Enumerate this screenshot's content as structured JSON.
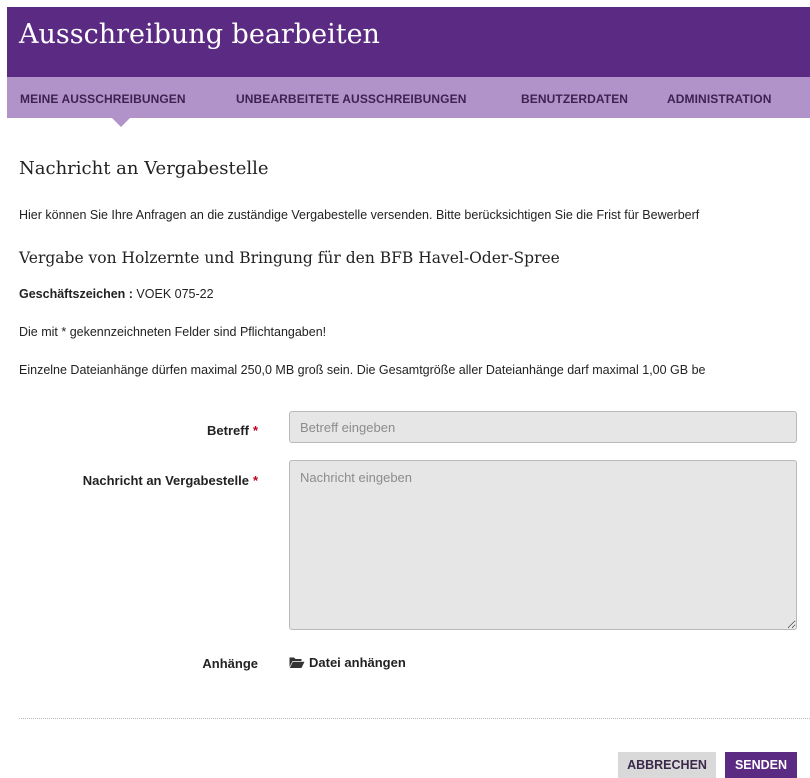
{
  "header": {
    "title": "Ausschreibung bearbeiten"
  },
  "nav": {
    "items": [
      {
        "label": "MEINE AUSSCHREIBUNGEN"
      },
      {
        "label": "UNBEARBEITETE AUSSCHREIBUNGEN"
      },
      {
        "label": "BENUTZERDATEN"
      },
      {
        "label": "ADMINISTRATION"
      }
    ],
    "active_index": 0
  },
  "page": {
    "title": "Nachricht an Vergabestelle",
    "intro": "Hier können Sie Ihre Anfragen an die zuständige Vergabestelle versenden. Bitte berücksichtigen Sie die Frist für Bewerberf",
    "tender_title": "Vergabe von Holzernte und Bringung für den BFB Havel-Oder-Spree",
    "reference_label": "Geschäftszeichen :",
    "reference_value": "VOEK 075-22",
    "required_note": "Die mit * gekennzeichneten Felder sind Pflichtangaben!",
    "file_note": "Einzelne Dateianhänge dürfen maximal 250,0 MB groß sein. Die Gesamtgröße aller Dateianhänge darf maximal 1,00 GB be"
  },
  "form": {
    "subject": {
      "label": "Betreff",
      "required_mark": "*",
      "value": "",
      "placeholder": "Betreff eingeben"
    },
    "message": {
      "label": "Nachricht an Vergabestelle",
      "required_mark": "*",
      "value": "",
      "placeholder": "Nachricht eingeben"
    },
    "attachments": {
      "label": "Anhänge",
      "action_label": "Datei anhängen",
      "icon": "folder-open-icon"
    }
  },
  "actions": {
    "cancel_label": "ABBRECHEN",
    "send_label": "SENDEN"
  },
  "colors": {
    "primary": "#5b2a82",
    "nav_bg": "#b293c9",
    "required": "#c0001a",
    "input_bg": "#e6e6e6",
    "cancel_bg": "#d9d9d9"
  }
}
